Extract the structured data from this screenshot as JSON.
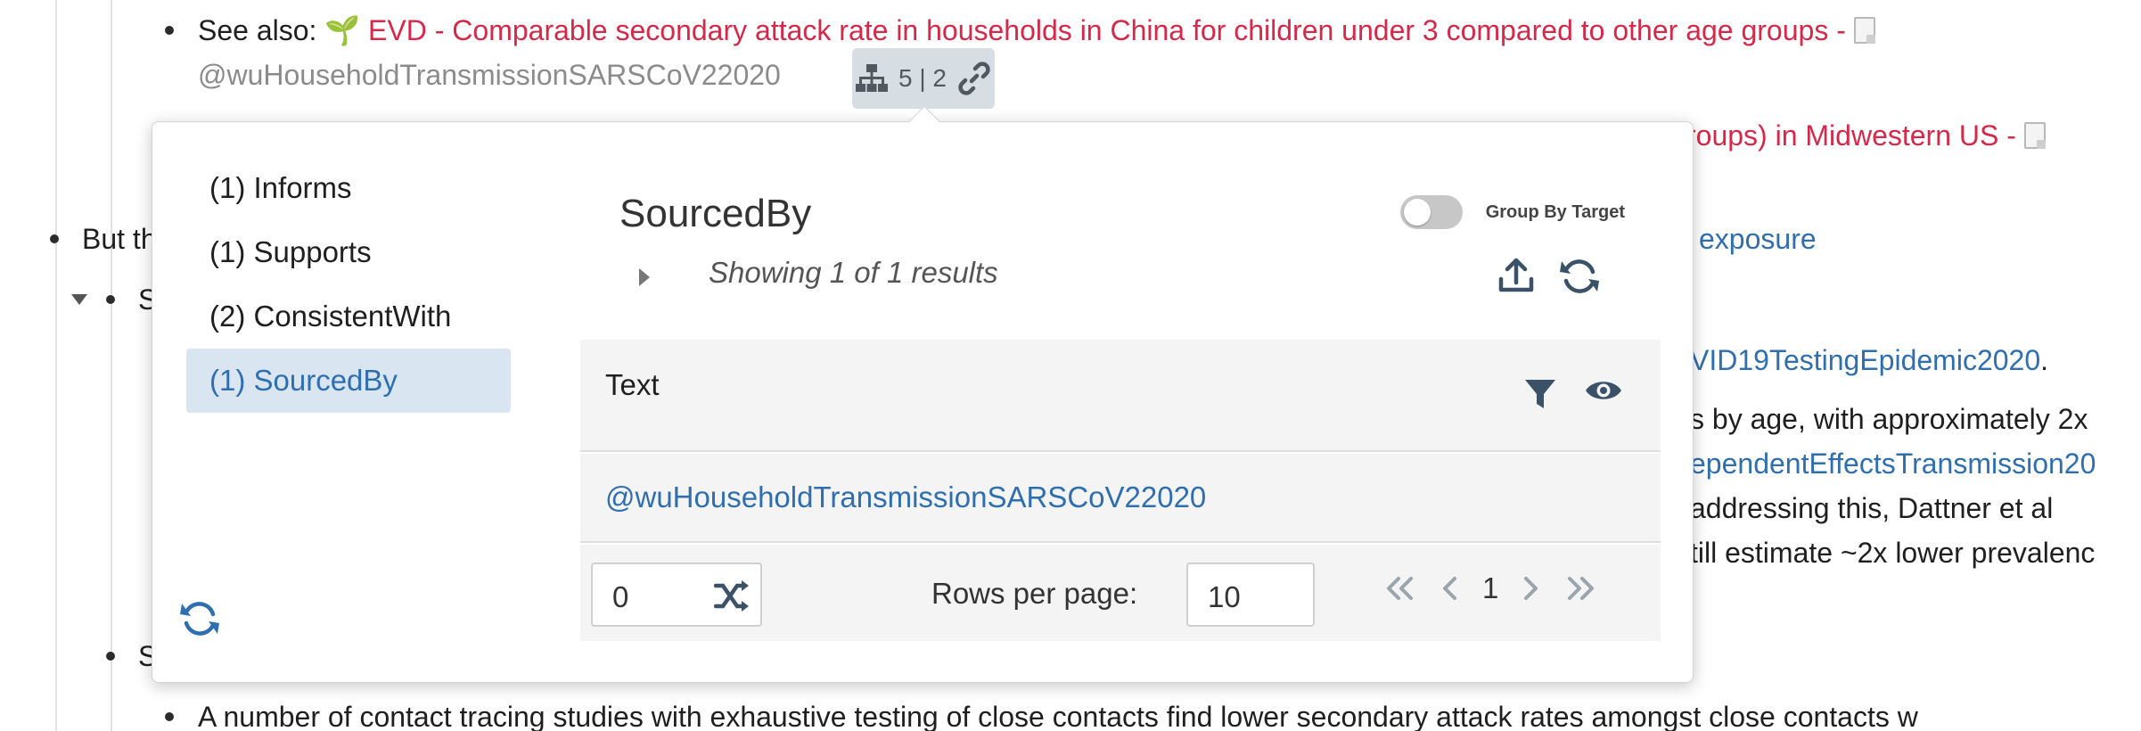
{
  "background": {
    "see_also_label": "See also:",
    "see_also_link": "EVD - Comparable secondary attack rate in households in China for children under 3 compared to other age groups -",
    "citation": "@wuHouseholdTransmissionSARSCoV22020",
    "badge_count": "5 | 2",
    "line2_fragment": "roups) in Midwestern US -",
    "line3_start": "But th",
    "line3_end": "exposure",
    "line4_start": "S",
    "line4_end": "VID19TestingEpidemic2020",
    "line4_period": ".",
    "line5": "s by age, with approximately 2x",
    "line6": "ependentEffectsTransmission20",
    "line7": "addressing this, Dattner et al",
    "line8": "till estimate ~2x lower prevalenc",
    "line9_start": "S",
    "line10": "A number of contact tracing studies with exhaustive testing of close contacts find lower secondary attack rates amongst close contacts w"
  },
  "popover": {
    "relations": [
      {
        "label": "(1) Informs"
      },
      {
        "label": "(1) Supports"
      },
      {
        "label": "(2) ConsistentWith"
      },
      {
        "label": "(1) SourcedBy"
      }
    ],
    "active_relation_index": 3,
    "title": "SourcedBy",
    "toggle_label": "Group By Target",
    "toggle_on": false,
    "results_text": "Showing 1 of 1 results",
    "table": {
      "column_header": "Text",
      "rows": [
        "@wuHouseholdTransmissionSARSCoV22020"
      ]
    },
    "footer": {
      "seed_value": "0",
      "rows_per_page_label": "Rows per page:",
      "rows_per_page_value": "10",
      "current_page": "1"
    }
  },
  "colors": {
    "link_red": "#d6294a",
    "link_blue": "#2f6fb0",
    "active_bg": "#d9e6f2"
  }
}
